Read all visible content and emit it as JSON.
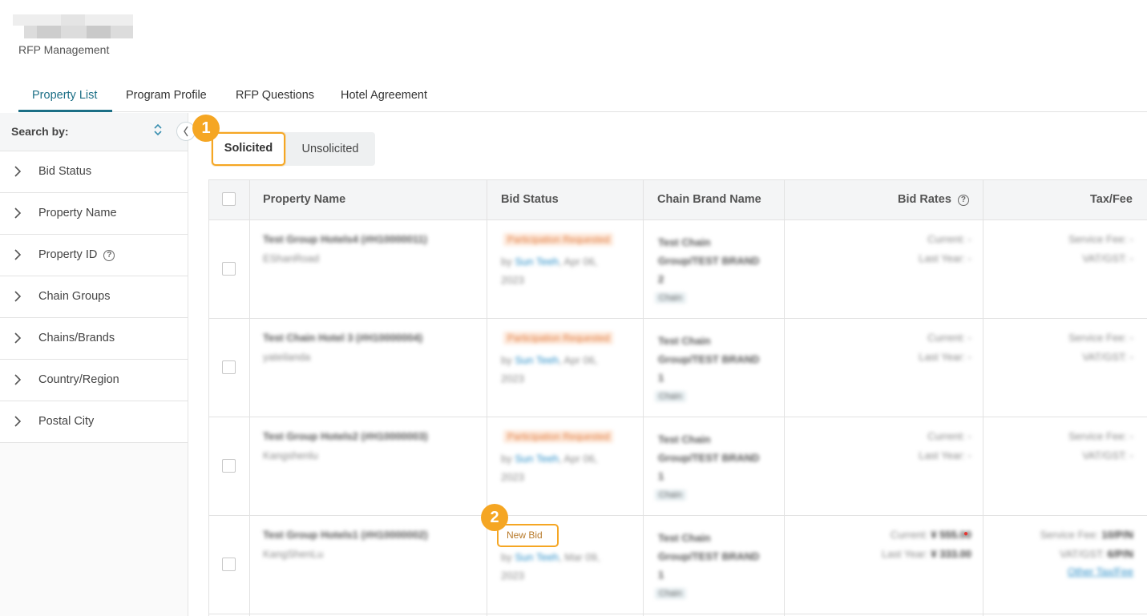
{
  "app": {
    "title": "RFP Management"
  },
  "tabs": [
    {
      "label": "Property List",
      "active": true
    },
    {
      "label": "Program Profile",
      "active": false
    },
    {
      "label": "RFP Questions",
      "active": false
    },
    {
      "label": "Hotel Agreement",
      "active": false
    }
  ],
  "sidebar": {
    "search_label": "Search by:",
    "filters": [
      {
        "label": "Bid Status"
      },
      {
        "label": "Property Name"
      },
      {
        "label": "Property ID",
        "help": "?"
      },
      {
        "label": "Chain Groups"
      },
      {
        "label": "Chains/Brands"
      },
      {
        "label": "Country/Region"
      },
      {
        "label": "Postal City"
      }
    ]
  },
  "segment": {
    "solicited": "Solicited",
    "unsolicited": "Unsolicited",
    "selected": "Solicited"
  },
  "callouts": {
    "one": "1",
    "two": "2"
  },
  "table": {
    "headers": {
      "property_name": "Property Name",
      "bid_status": "Bid Status",
      "chain_brand": "Chain Brand Name",
      "bid_rates": "Bid Rates",
      "bid_rates_help": "?",
      "tax_fee": "Tax/Fee"
    },
    "rows": [
      {
        "name": "Test Group Hotels4 (#H10000011)",
        "sub": "EShanRoad",
        "status": "Participation Requested",
        "by_prefix": "by ",
        "by_user": "Sun Teeh",
        "by_date": ", Apr 06,",
        "by_year": "2023",
        "chain_line1": "Test Chain",
        "chain_line2": "Group/TEST BRAND",
        "chain_line3": "2",
        "chip": "Chain",
        "rate_current": "Current: -",
        "rate_last": "Last Year: -",
        "tax_service": "Service Fee: -",
        "tax_vat": "VAT/GST: -"
      },
      {
        "name": "Test Chain Hotel 3 (#H10000004)",
        "sub": "yateilanda",
        "status": "Participation Requested",
        "by_prefix": "by ",
        "by_user": "Sun Teeh",
        "by_date": ", Apr 06,",
        "by_year": "2023",
        "chain_line1": "Test Chain",
        "chain_line2": "Group/TEST BRAND",
        "chain_line3": "1",
        "chip": "Chain",
        "rate_current": "Current: -",
        "rate_last": "Last Year: -",
        "tax_service": "Service Fee: -",
        "tax_vat": "VAT/GST: -"
      },
      {
        "name": "Test Group Hotels2 (#H10000003)",
        "sub": "Kangshenlu",
        "status": "Participation Requested",
        "by_prefix": "by ",
        "by_user": "Sun Teeh",
        "by_date": ", Apr 06,",
        "by_year": "2023",
        "chain_line1": "Test Chain",
        "chain_line2": "Group/TEST BRAND",
        "chain_line3": "1",
        "chip": "Chain",
        "rate_current": "Current: -",
        "rate_last": "Last Year: -",
        "tax_service": "Service Fee: -",
        "tax_vat": "VAT/GST: -"
      },
      {
        "name": "Test Group Hotels1 (#H10000002)",
        "sub": "KangShenLu",
        "status": "New Bid",
        "by_prefix": "by ",
        "by_user": "Sun Teeh",
        "by_date": ", Mar 09,",
        "by_year": "2023",
        "chain_line1": "Test Chain",
        "chain_line2": "Group/TEST BRAND",
        "chain_line3": "1",
        "chip": "Chain",
        "rate_current_label": "Current:",
        "rate_current_value": "¥ 555.00",
        "rate_last_label": "Last Year:",
        "rate_last_value": "¥ 333.00",
        "tax_service_label": "Service Fee:",
        "tax_service_value": "10/P/N",
        "tax_vat_label": "VAT/GST:",
        "tax_vat_value": "6/P/N",
        "other_tax": "Other Tax/Fee"
      }
    ]
  },
  "colors": {
    "accent": "#1c6f86",
    "highlight": "#f5a623",
    "link": "#2a8ec7"
  }
}
